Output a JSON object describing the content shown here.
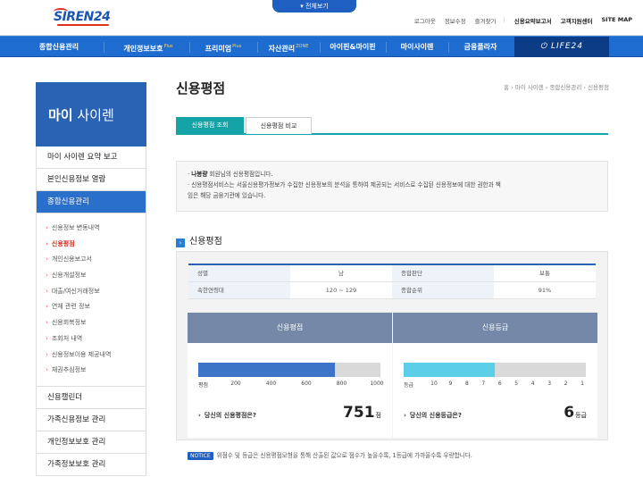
{
  "header": {
    "logo_text": "SIREN24",
    "all_view": "▾ 전체보기",
    "top_links": [
      "로그아웃",
      "정보수정",
      "즐겨찾기"
    ],
    "top_links_bold": [
      "신용요약보고서",
      "고객지원센터",
      "SITE MAP"
    ]
  },
  "gnb": {
    "items": [
      {
        "label": "종합신용관리",
        "badge": ""
      },
      {
        "label": "개인정보보호",
        "badge": "Plus"
      },
      {
        "label": "프리미엄",
        "badge": "Plus"
      },
      {
        "label": "자산관리",
        "badge": "ZONE"
      },
      {
        "label": "아이핀&마이핀",
        "badge": ""
      },
      {
        "label": "마이사이렌",
        "badge": ""
      },
      {
        "label": "금융플라자",
        "badge": ""
      }
    ],
    "life": "LIFE24"
  },
  "side": {
    "title_bold": "마이",
    "title_rest": " 사이렌",
    "menu_top": [
      "마이 사이렌 요약 보고",
      "본인신용정보 열람"
    ],
    "active": "종합신용관리",
    "sub": [
      {
        "label": "신용정보 변동내역",
        "on": false
      },
      {
        "label": "신용평점",
        "on": true
      },
      {
        "label": "개인신용보고서",
        "on": false
      },
      {
        "label": "신용개설정보",
        "on": false
      },
      {
        "label": "대출/여신거래정보",
        "on": false
      },
      {
        "label": "연체 관련 정보",
        "on": false
      },
      {
        "label": "신용회복정보",
        "on": false
      },
      {
        "label": "조회처 내역",
        "on": false
      },
      {
        "label": "신용정보이용 제공내역",
        "on": false
      },
      {
        "label": "채권추심정보",
        "on": false
      }
    ],
    "menu_bottom": [
      "신용캘린더",
      "가족신용정보 관리",
      "개인정보보호 관리",
      "가족정보보호 관리"
    ]
  },
  "content": {
    "title": "신용평점",
    "breadcrumb": "홈 › 마이 사이렌 › 종합신용관리 › 신용평점",
    "tab_active": "신용평점 조회",
    "tab_other": "신용평점 비교",
    "info_name": "나봉량",
    "info_line1_rest": " 회원님의 신용평점입니다.",
    "info_line2": "· 신용평점서비스는 서울신용평가정보가 수집한 신용정보의 분석을 통하여 제공되는 서비스로 수집된 신용정보에 대한 권한과 책",
    "info_line3": "  임은 해당 금융기관에 있습니다.",
    "section_title": "신용평점",
    "table": {
      "r1": [
        "성별",
        "남",
        "종합판단",
        "보통"
      ],
      "r2": [
        "속한연령대",
        "120 ~ 129",
        "종합순위",
        "91%"
      ]
    },
    "score_card": {
      "header": "신용평점",
      "axis_prefix": "평점",
      "ticks": [
        "200",
        "400",
        "600",
        "800",
        "1000"
      ],
      "question": "당신의 신용평점은?",
      "answer": "751",
      "unit": "점",
      "fill_fraction": 0.751,
      "color": "#3d74c8"
    },
    "grade_card": {
      "header": "신용등급",
      "axis_prefix": "등급",
      "ticks": [
        "10",
        "9",
        "8",
        "7",
        "6",
        "5",
        "4",
        "3",
        "2",
        "1"
      ],
      "question": "당신의 신용등급은?",
      "answer": "6",
      "unit": "등급",
      "fill_fraction": 0.5,
      "color": "#5bcfe8"
    },
    "notice_tag": "NOTICE",
    "notice_text": "위점수 및 등급은 신용평점모형을 통해 산출된 값으로 점수가 높을수록, 1등급에 가까울수록 우량합니다."
  }
}
